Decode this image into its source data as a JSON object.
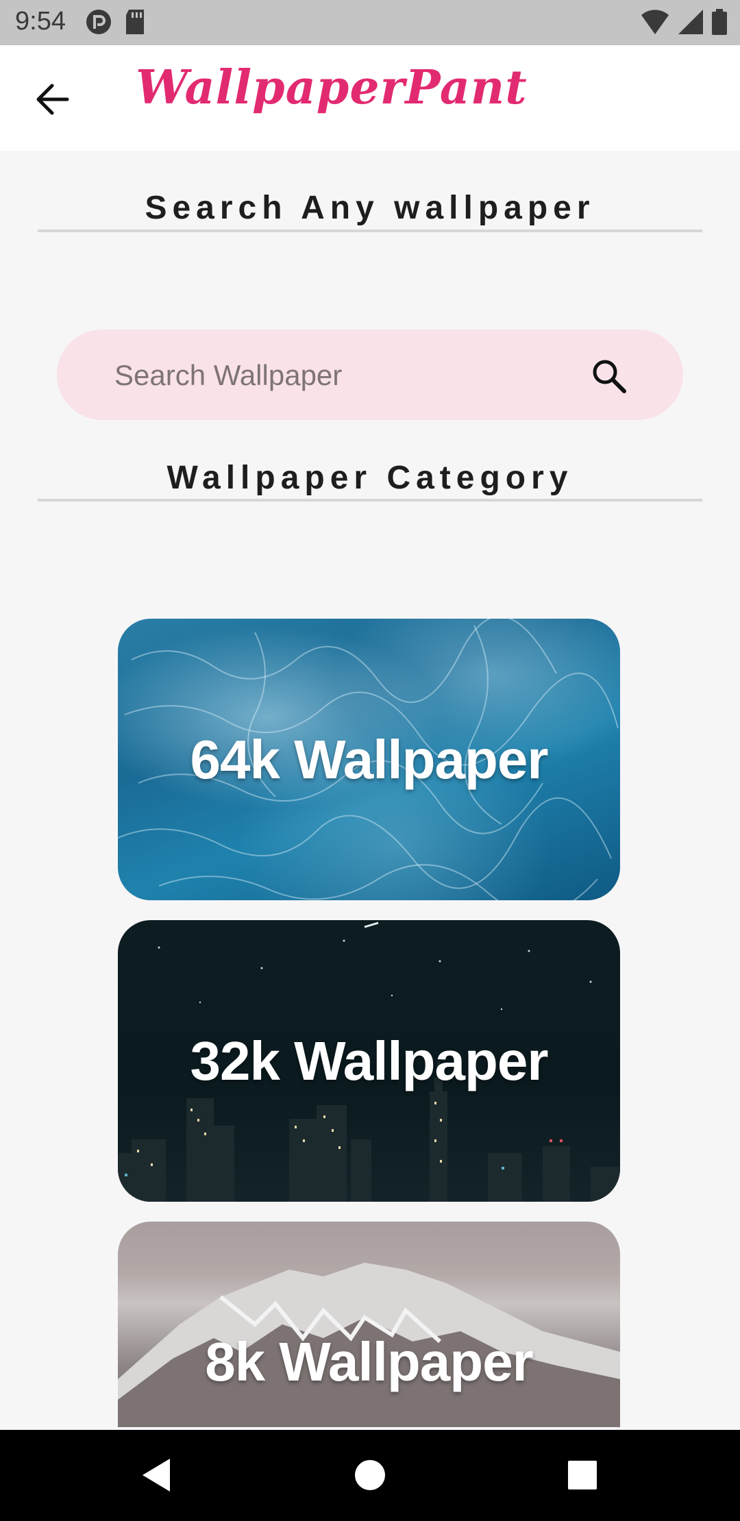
{
  "status_bar": {
    "time": "9:54"
  },
  "app_bar": {
    "title": "WallpaperPant"
  },
  "sections": {
    "search_heading": "Search Any wallpaper",
    "category_heading": "Wallpaper Category"
  },
  "search": {
    "placeholder": "Search Wallpaper",
    "value": ""
  },
  "categories": [
    {
      "label": "64k Wallpaper"
    },
    {
      "label": "32k Wallpaper"
    },
    {
      "label": "8k Wallpaper"
    }
  ],
  "colors": {
    "brand": "#e22a71",
    "search_bg": "#f9e2e8"
  }
}
